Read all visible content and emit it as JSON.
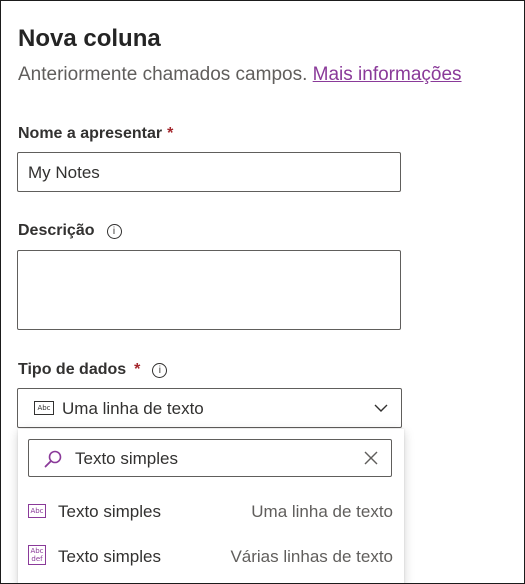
{
  "header": {
    "title": "Nova coluna",
    "subtitle": "Anteriormente chamados campos.",
    "more_info_link": "Mais informações"
  },
  "display_name": {
    "label": "Nome a apresentar",
    "required_mark": "*",
    "value": "My Notes"
  },
  "description": {
    "label": "Descrição",
    "info_icon": "info-icon",
    "value": ""
  },
  "data_type": {
    "label": "Tipo de dados",
    "required_mark": "*",
    "info_icon": "info-icon",
    "selected_icon_text": "Abc",
    "selected_value": "Uma linha de texto",
    "chevron_icon": "chevron-down-icon"
  },
  "dropdown_menu": {
    "search_value": "Texto simples",
    "search_icon": "search-icon",
    "clear_icon": "close-icon",
    "options": [
      {
        "icon_text": "Abc",
        "label": "Texto simples",
        "description": "Uma linha de texto"
      },
      {
        "icon_text": "Abc def",
        "icon_line1": "Abc",
        "icon_line2": "def",
        "label": "Texto simples",
        "description": "Várias linhas de texto"
      }
    ]
  },
  "colors": {
    "accent_purple": "#8a3a99",
    "required_red": "#a4262c",
    "text": "#323130",
    "border": "#605e5c"
  }
}
